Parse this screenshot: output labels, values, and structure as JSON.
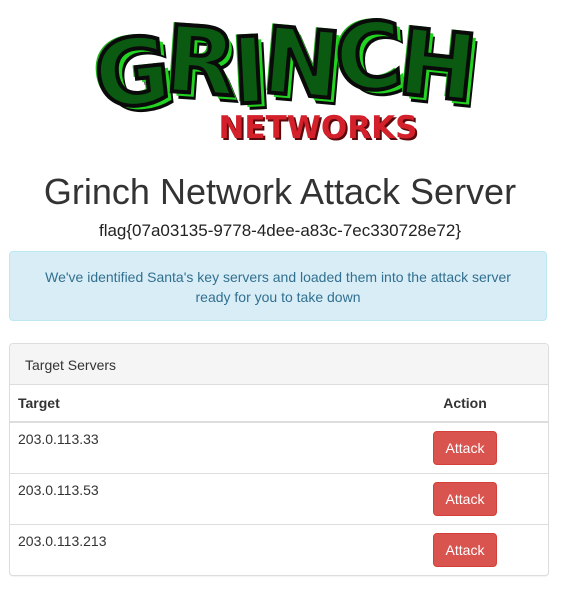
{
  "logo": {
    "word_letters": [
      "G",
      "R",
      "I",
      "N",
      "C",
      "H"
    ],
    "subtitle": "NETWORKS",
    "colors": {
      "green": "#23d321",
      "dark_green": "#0b5a12",
      "outline": "#0a0a0a",
      "red": "#d3202a"
    }
  },
  "page": {
    "title": "Grinch Network Attack Server",
    "flag": "flag{07a03135-9778-4dee-a83c-7ec330728e72}"
  },
  "alert": {
    "message": "We've identified Santa's key servers and loaded them into the attack server ready for you to take down",
    "color": "#31708f",
    "background": "#d9edf7"
  },
  "panel": {
    "heading": "Target Servers",
    "columns": {
      "target": "Target",
      "action": "Action"
    },
    "rows": [
      {
        "target": "203.0.113.33",
        "action_label": "Attack"
      },
      {
        "target": "203.0.113.53",
        "action_label": "Attack"
      },
      {
        "target": "203.0.113.213",
        "action_label": "Attack"
      }
    ],
    "button_color": "#d9534f"
  }
}
